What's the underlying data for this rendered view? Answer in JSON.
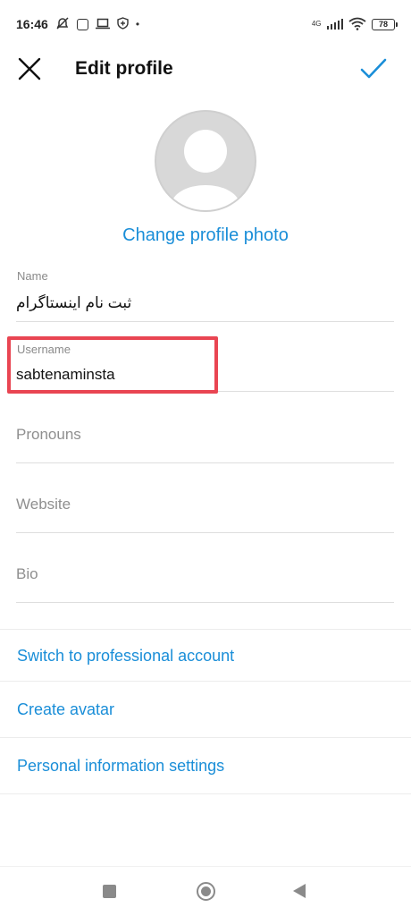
{
  "status_bar": {
    "time": "16:46",
    "network_type": "4G",
    "battery": "78"
  },
  "header": {
    "title": "Edit profile",
    "close_icon": "close-icon",
    "confirm_icon": "checkmark-icon"
  },
  "profile": {
    "avatar_icon": "default-avatar-icon",
    "change_photo_label": "Change profile photo"
  },
  "fields": {
    "name": {
      "label": "Name",
      "value": "ثبت نام اینستاگرام"
    },
    "username": {
      "label": "Username",
      "value": "sabtenaminsta"
    },
    "pronouns": {
      "placeholder": "Pronouns"
    },
    "website": {
      "placeholder": "Website"
    },
    "bio": {
      "placeholder": "Bio"
    }
  },
  "links": {
    "professional": "Switch to professional account",
    "avatar": "Create avatar",
    "personal_info": "Personal information settings"
  },
  "colors": {
    "accent": "#1a8ed8",
    "highlight": "#e94552"
  },
  "nav_bar": {
    "recents_icon": "square-icon",
    "home_icon": "circle-icon",
    "back_icon": "back-triangle-icon"
  }
}
